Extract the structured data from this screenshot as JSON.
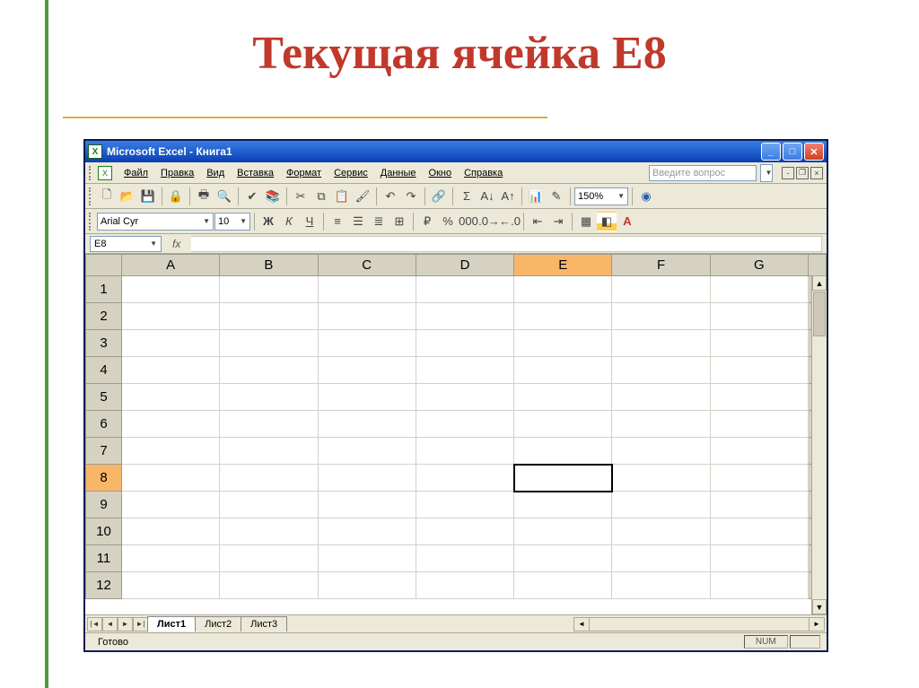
{
  "slide": {
    "title": "Текущая ячейка Е8"
  },
  "window": {
    "title": "Microsoft Excel - Книга1",
    "app_abbrev": "X"
  },
  "menu": {
    "file": "Файл",
    "edit": "Правка",
    "view": "Вид",
    "insert": "Вставка",
    "format": "Формат",
    "tools": "Сервис",
    "data": "Данные",
    "window_m": "Окно",
    "help": "Справка",
    "help_placeholder": "Введите вопрос"
  },
  "toolbar2": {
    "font": "Arial Cyr",
    "size": "10",
    "bold": "Ж",
    "italic": "К",
    "underline": "Ч"
  },
  "toolbar1": {
    "zoom": "150%"
  },
  "formula": {
    "namebox": "E8",
    "fx": "fx"
  },
  "columns": [
    "A",
    "B",
    "C",
    "D",
    "E",
    "F",
    "G"
  ],
  "rows": [
    "1",
    "2",
    "3",
    "4",
    "5",
    "6",
    "7",
    "8",
    "9",
    "10",
    "11",
    "12"
  ],
  "active": {
    "col": "E",
    "row": "8"
  },
  "sheets": {
    "s1": "Лист1",
    "s2": "Лист2",
    "s3": "Лист3"
  },
  "status": {
    "ready": "Готово",
    "num": "NUM"
  }
}
